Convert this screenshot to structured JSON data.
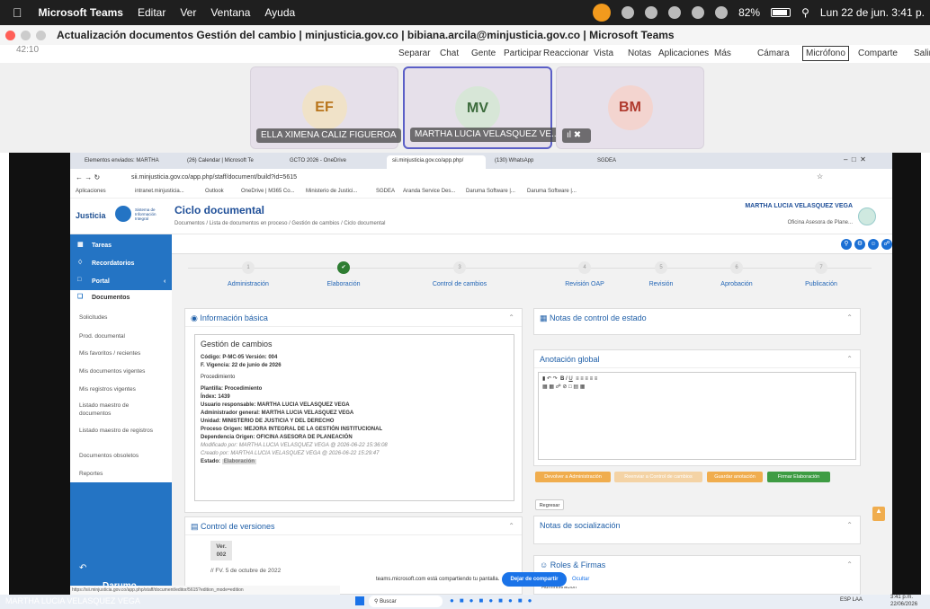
{
  "mac": {
    "app": "Microsoft Teams",
    "menu": [
      "Editar",
      "Ver",
      "Ventana",
      "Ayuda"
    ],
    "battery": "82%",
    "clock": "Lun 22 de jun.  3:41 p."
  },
  "window": {
    "title": "Actualización documentos Gestión del cambio | minjusticia.gov.co | bibiana.arcila@minjusticia.gov.co | Microsoft Teams",
    "timer": "42:10"
  },
  "teams_toolbar": [
    "Separar",
    "Chat",
    "Gente",
    "Participar",
    "Reaccionar",
    "Vista",
    "Notas",
    "Aplicaciones",
    "Más",
    "Cámara",
    "Micrófono",
    "Comparte",
    "Salir"
  ],
  "participants": [
    {
      "initials": "EF",
      "name": "ELLA XIMENA CALIZ FIGUEROA",
      "bg": "#f0e2c8",
      "fg": "#b8741a"
    },
    {
      "initials": "MV",
      "name": "MARTHA LUCIA VELASQUEZ VE...",
      "bg": "#d7e6d7",
      "fg": "#3c6b3c"
    },
    {
      "initials": "BM",
      "name": "",
      "bg": "#f3d4cf",
      "fg": "#b03a2e"
    }
  ],
  "browser": {
    "tabs": [
      "Elementos enviados: MARTHA",
      "(26) Calendar | Microsoft Te",
      "GCTO 2026 - OneDrive",
      "sii.minjusticia.gov.co/app.php/",
      "(130) WhatsApp",
      "SGDEA"
    ],
    "url": "sii.minjusticia.gov.co/app.php/staff/document/build?id=5615",
    "bookmarks": [
      "Aplicaciones",
      "intranet.minjusticia...",
      "Outlook",
      "OneDrive | M365 Co...",
      "Ministerio de Justici...",
      "SGDEA",
      "Aranda Service Des...",
      "Daruma Software |...",
      "Daruma Software |..."
    ]
  },
  "app": {
    "logo": "Justicia",
    "logo_sub": "Sistema de Información Integral",
    "title": "Ciclo documental",
    "breadcrumb": "Documentos  /  Lista de documentos en proceso  /  Gestión de cambios  /  Ciclo documental",
    "user": "MARTHA LUCIA VELASQUEZ VEGA",
    "user_role": "Oficina Asesora de Plane...",
    "sidebar": [
      "Tareas",
      "Recordatorios",
      "Portal",
      "Documentos"
    ],
    "submenu": [
      "Solicitudes",
      "Prod. documental",
      "Mis favoritos / recientes",
      "Mis documentos vigentes",
      "Mis registros vigentes",
      "Listado maestro de documentos",
      "Listado maestro de registros",
      "Documentos obsoletos",
      "Reportes"
    ],
    "brand": "Darumo",
    "steps": [
      {
        "n": "1",
        "label": "Administración"
      },
      {
        "n": "",
        "label": "Elaboración"
      },
      {
        "n": "3",
        "label": "Control de cambios"
      },
      {
        "n": "4",
        "label": "Revisión OAP"
      },
      {
        "n": "5",
        "label": "Revisión"
      },
      {
        "n": "6",
        "label": "Aprobación"
      },
      {
        "n": "7",
        "label": "Publicación"
      }
    ],
    "info": {
      "header": "Información básica",
      "title": "Gestión de cambios",
      "codigo": "Código: P-MC-05   Versión: 004",
      "vigencia": "F. Vigencia: 22 de junio de 2026",
      "tipo": "Procedimiento",
      "plantilla": "Plantilla: Procedimiento",
      "index": "Índex: 1439",
      "responsable": "Usuario responsable: MARTHA LUCIA VELASQUEZ VEGA",
      "admin": "Administrador general: MARTHA LUCIA VELASQUEZ VEGA",
      "unidad": "Unidad: MINISTERIO DE JUSTICIA Y DEL DERECHO",
      "proceso": "Proceso Origen: MEJORA INTEGRAL DE LA GESTIÓN INSTITUCIONAL",
      "dependencia": "Dependencia Origen: OFICINA ASESORA DE PLANEACIÓN",
      "modificado": "Modificado por: MARTHA LUCIA VELASQUEZ VEGA @ 2026-06-22 15:36:08",
      "creado": "Creado por: MARTHA LUCIA VELASQUEZ VEGA @ 2026-06-22 15:29:47",
      "estado_label": "Estado:",
      "estado": "Elaboración"
    },
    "versions": {
      "header": "Control de versiones",
      "ver": "Ver.",
      "num": "002",
      "date": "// FV. 5 de octubre de 2022"
    },
    "notes_state": "Notas de control de estado",
    "annotation": "Anotación global",
    "buttons": [
      "Devolver a Administración",
      "Reenviar a Control de cambios",
      "Guardar anotación",
      "Firmar Elaboración"
    ],
    "regresar": "Regresar",
    "socializacion": "Notas de socialización",
    "roles": "Roles & Firmas",
    "admin_small": "Administración"
  },
  "sharing": {
    "text": "teams.microsoft.com está compartiendo tu pantalla.",
    "stop": "Dejar de compartir",
    "hide": "Ocultar"
  },
  "status_url": "https://sii.minjusticia.gov.co/app.php/staff/document/editor/5615?edition_mode=edition",
  "speaker": "MARTHA LUCIA VELASQUEZ VEGA",
  "taskbar": {
    "search": "Buscar",
    "lang": "ESP LAA",
    "time": "3:41 p.m.",
    "date": "22/06/2026"
  }
}
